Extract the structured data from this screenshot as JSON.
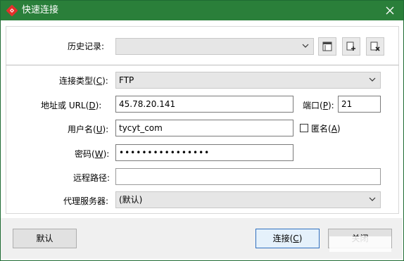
{
  "window": {
    "title": "快速连接",
    "close_icon": "close-icon"
  },
  "history": {
    "label": "历史记录:",
    "value": ""
  },
  "connection_type": {
    "label_prefix": "连接类型(",
    "label_key": "C",
    "label_suffix": "):",
    "value": "FTP"
  },
  "address": {
    "label_prefix": "地址或 URL(",
    "label_key": "D",
    "label_suffix": "):",
    "value": "45.78.20.141"
  },
  "port": {
    "label_prefix": "端口(",
    "label_key": "P",
    "label_suffix": "):",
    "value": "21"
  },
  "username": {
    "label_prefix": "用户名(",
    "label_key": "U",
    "label_suffix": "):",
    "value": "tycyt_com"
  },
  "anonymous": {
    "label_prefix": "匿名(",
    "label_key": "A",
    "label_suffix": ")",
    "checked": false
  },
  "password": {
    "label_prefix": "密码(",
    "label_key": "W",
    "label_suffix": "):",
    "value": "••••••••••••••••"
  },
  "remote_path": {
    "label": "远程路径:",
    "value": ""
  },
  "proxy": {
    "label": "代理服务器:",
    "value": "(默认)"
  },
  "buttons": {
    "default_label": "默认",
    "connect_prefix": "连接(",
    "connect_key": "C",
    "connect_suffix": ")",
    "close_label": "关闭"
  },
  "colors": {
    "titlebar": "#2a7f3a",
    "accent_border": "#2f6fbf"
  }
}
